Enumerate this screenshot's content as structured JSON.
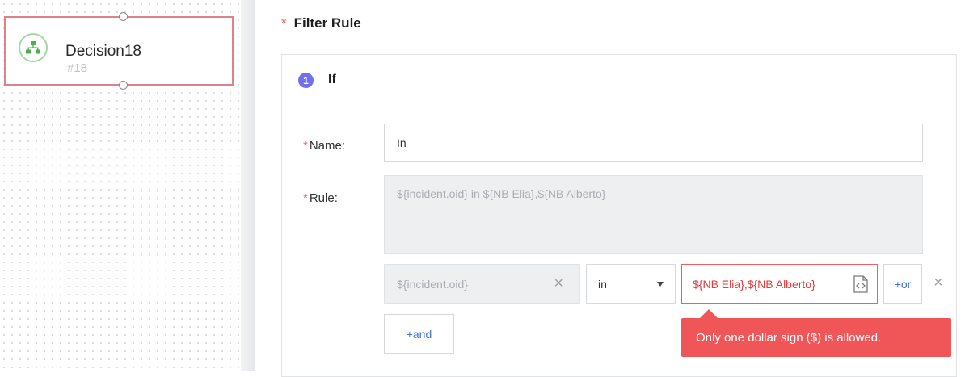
{
  "node": {
    "title": "Decision18",
    "subtitle": "#18",
    "icon": "org-chart-icon",
    "border_color": "#e0808a",
    "icon_color": "#4caf50"
  },
  "form": {
    "section_title": "Filter Rule",
    "required_mark": "*",
    "step_number": "1",
    "step_label": "If",
    "name_label": "Name:",
    "name_value": "In",
    "rule_label": "Rule:",
    "rule_value": "${incident.oid} in ${NB Elia},${NB Alberto}",
    "condition": {
      "field": "${incident.oid}",
      "operator": "in",
      "value": "${NB Elia},${NB Alberto}",
      "or_label": "+or",
      "clear_glyph": "×",
      "remove_glyph": "×"
    },
    "and_label": "+and",
    "error_tooltip": "Only one dollar sign ($) is allowed.",
    "colors": {
      "accent": "#3b74e0",
      "error": "#f05558",
      "badge": "#6f6ff0"
    }
  }
}
